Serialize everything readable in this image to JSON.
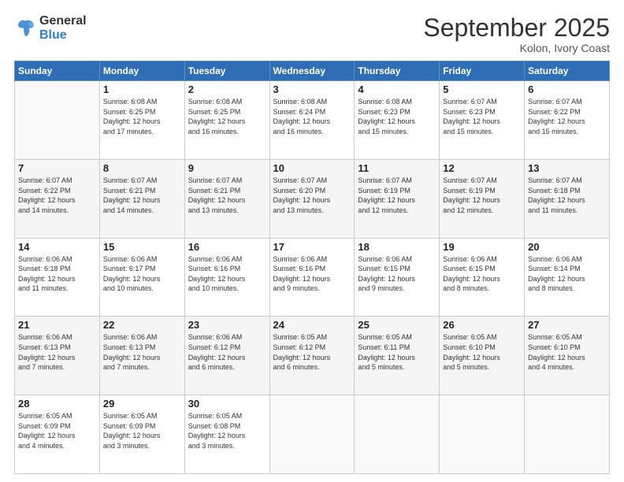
{
  "logo": {
    "line1": "General",
    "line2": "Blue"
  },
  "title": "September 2025",
  "subtitle": "Kolon, Ivory Coast",
  "headers": [
    "Sunday",
    "Monday",
    "Tuesday",
    "Wednesday",
    "Thursday",
    "Friday",
    "Saturday"
  ],
  "weeks": [
    [
      {
        "day": "",
        "info": ""
      },
      {
        "day": "1",
        "info": "Sunrise: 6:08 AM\nSunset: 6:25 PM\nDaylight: 12 hours\nand 17 minutes."
      },
      {
        "day": "2",
        "info": "Sunrise: 6:08 AM\nSunset: 6:25 PM\nDaylight: 12 hours\nand 16 minutes."
      },
      {
        "day": "3",
        "info": "Sunrise: 6:08 AM\nSunset: 6:24 PM\nDaylight: 12 hours\nand 16 minutes."
      },
      {
        "day": "4",
        "info": "Sunrise: 6:08 AM\nSunset: 6:23 PM\nDaylight: 12 hours\nand 15 minutes."
      },
      {
        "day": "5",
        "info": "Sunrise: 6:07 AM\nSunset: 6:23 PM\nDaylight: 12 hours\nand 15 minutes."
      },
      {
        "day": "6",
        "info": "Sunrise: 6:07 AM\nSunset: 6:22 PM\nDaylight: 12 hours\nand 15 minutes."
      }
    ],
    [
      {
        "day": "7",
        "info": "Sunrise: 6:07 AM\nSunset: 6:22 PM\nDaylight: 12 hours\nand 14 minutes."
      },
      {
        "day": "8",
        "info": "Sunrise: 6:07 AM\nSunset: 6:21 PM\nDaylight: 12 hours\nand 14 minutes."
      },
      {
        "day": "9",
        "info": "Sunrise: 6:07 AM\nSunset: 6:21 PM\nDaylight: 12 hours\nand 13 minutes."
      },
      {
        "day": "10",
        "info": "Sunrise: 6:07 AM\nSunset: 6:20 PM\nDaylight: 12 hours\nand 13 minutes."
      },
      {
        "day": "11",
        "info": "Sunrise: 6:07 AM\nSunset: 6:19 PM\nDaylight: 12 hours\nand 12 minutes."
      },
      {
        "day": "12",
        "info": "Sunrise: 6:07 AM\nSunset: 6:19 PM\nDaylight: 12 hours\nand 12 minutes."
      },
      {
        "day": "13",
        "info": "Sunrise: 6:07 AM\nSunset: 6:18 PM\nDaylight: 12 hours\nand 11 minutes."
      }
    ],
    [
      {
        "day": "14",
        "info": "Sunrise: 6:06 AM\nSunset: 6:18 PM\nDaylight: 12 hours\nand 11 minutes."
      },
      {
        "day": "15",
        "info": "Sunrise: 6:06 AM\nSunset: 6:17 PM\nDaylight: 12 hours\nand 10 minutes."
      },
      {
        "day": "16",
        "info": "Sunrise: 6:06 AM\nSunset: 6:16 PM\nDaylight: 12 hours\nand 10 minutes."
      },
      {
        "day": "17",
        "info": "Sunrise: 6:06 AM\nSunset: 6:16 PM\nDaylight: 12 hours\nand 9 minutes."
      },
      {
        "day": "18",
        "info": "Sunrise: 6:06 AM\nSunset: 6:15 PM\nDaylight: 12 hours\nand 9 minutes."
      },
      {
        "day": "19",
        "info": "Sunrise: 6:06 AM\nSunset: 6:15 PM\nDaylight: 12 hours\nand 8 minutes."
      },
      {
        "day": "20",
        "info": "Sunrise: 6:06 AM\nSunset: 6:14 PM\nDaylight: 12 hours\nand 8 minutes."
      }
    ],
    [
      {
        "day": "21",
        "info": "Sunrise: 6:06 AM\nSunset: 6:13 PM\nDaylight: 12 hours\nand 7 minutes."
      },
      {
        "day": "22",
        "info": "Sunrise: 6:06 AM\nSunset: 6:13 PM\nDaylight: 12 hours\nand 7 minutes."
      },
      {
        "day": "23",
        "info": "Sunrise: 6:06 AM\nSunset: 6:12 PM\nDaylight: 12 hours\nand 6 minutes."
      },
      {
        "day": "24",
        "info": "Sunrise: 6:05 AM\nSunset: 6:12 PM\nDaylight: 12 hours\nand 6 minutes."
      },
      {
        "day": "25",
        "info": "Sunrise: 6:05 AM\nSunset: 6:11 PM\nDaylight: 12 hours\nand 5 minutes."
      },
      {
        "day": "26",
        "info": "Sunrise: 6:05 AM\nSunset: 6:10 PM\nDaylight: 12 hours\nand 5 minutes."
      },
      {
        "day": "27",
        "info": "Sunrise: 6:05 AM\nSunset: 6:10 PM\nDaylight: 12 hours\nand 4 minutes."
      }
    ],
    [
      {
        "day": "28",
        "info": "Sunrise: 6:05 AM\nSunset: 6:09 PM\nDaylight: 12 hours\nand 4 minutes."
      },
      {
        "day": "29",
        "info": "Sunrise: 6:05 AM\nSunset: 6:09 PM\nDaylight: 12 hours\nand 3 minutes."
      },
      {
        "day": "30",
        "info": "Sunrise: 6:05 AM\nSunset: 6:08 PM\nDaylight: 12 hours\nand 3 minutes."
      },
      {
        "day": "",
        "info": ""
      },
      {
        "day": "",
        "info": ""
      },
      {
        "day": "",
        "info": ""
      },
      {
        "day": "",
        "info": ""
      }
    ]
  ]
}
